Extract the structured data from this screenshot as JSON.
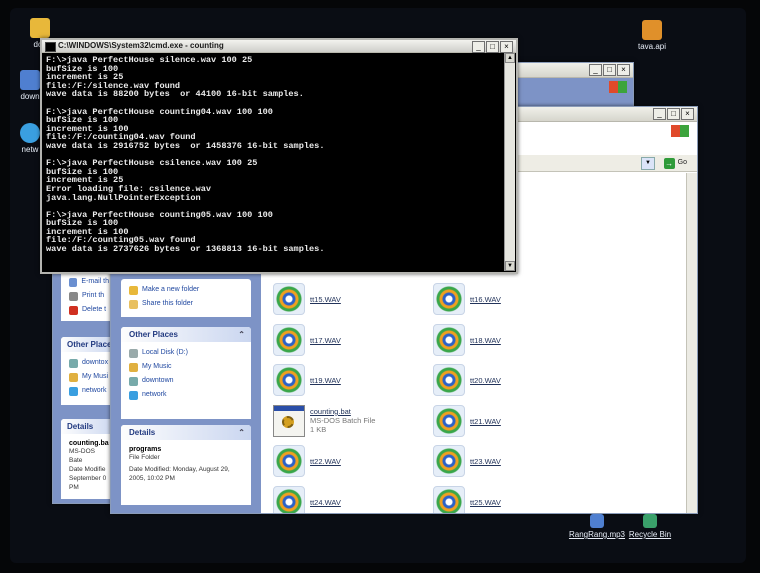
{
  "desktop": {
    "icons": [
      {
        "label": "doc",
        "icon": "folder-icon"
      },
      {
        "label": "down",
        "icon": "computer-icon"
      },
      {
        "label": "netw",
        "icon": "network-icon"
      },
      {
        "label": "tava.api",
        "icon": "key-icon"
      }
    ],
    "bottom_icons": [
      {
        "label": "RangRang.mp3",
        "icon": "audio-file-icon"
      },
      {
        "label": "Recycle Bin",
        "icon": "recycle-bin-icon"
      }
    ]
  },
  "cmd": {
    "title": "C:\\WINDOWS\\System32\\cmd.exe - counting",
    "lines": [
      "F:\\>java PerfectHouse silence.wav 100 25",
      "bufSize is 100",
      "increment is 25",
      "file:/F:/silence.wav found",
      "wave data is 88200 bytes  or 44100 16-bit samples.",
      "",
      "F:\\>java PerfectHouse counting04.wav 100 100",
      "bufSize is 100",
      "increment is 100",
      "file:/F:/counting04.wav found",
      "wave data is 2916752 bytes  or 1458376 16-bit samples.",
      "",
      "F:\\>java PerfectHouse csilence.wav 100 25",
      "bufSize is 100",
      "increment is 25",
      "Error loading file: csilence.wav",
      "java.lang.NullPointerException",
      "",
      "F:\\>java PerfectHouse counting05.wav 100 100",
      "bufSize is 100",
      "increment is 100",
      "file:/F:/counting05.wav found",
      "wave data is 2737626 bytes  or 1368813 16-bit samples."
    ]
  },
  "explorer_back": {
    "tasks": [
      "E-mail th",
      "Print th",
      "Delete t"
    ],
    "other_places_title": "Other Places",
    "other_places": [
      "downtox",
      "My Musi",
      "network"
    ],
    "details_title": "Details",
    "details_name": "counting.ba",
    "details_lines": [
      "MS-DOS Bate",
      "Date Modifie",
      "September 0",
      "PM"
    ]
  },
  "explorer_front": {
    "go_label": "Go",
    "tasks": [
      "Make a new folder",
      "Share this folder"
    ],
    "other_places_title": "Other Places",
    "other_places": [
      "Local Disk (D:)",
      "My Music",
      "downtown",
      "network"
    ],
    "details_title": "Details",
    "details_name": "programs",
    "details_type": "File Folder",
    "details_date": "Date Modified: Monday, August 29, 2005, 10:02 PM",
    "files": [
      {
        "name": "tt15.WAV",
        "kind": "wav"
      },
      {
        "name": "tt16.WAV",
        "kind": "wav"
      },
      {
        "name": "tt17.WAV",
        "kind": "wav"
      },
      {
        "name": "tt18.WAV",
        "kind": "wav"
      },
      {
        "name": "tt19.WAV",
        "kind": "wav"
      },
      {
        "name": "tt20.WAV",
        "kind": "wav"
      },
      {
        "name": "counting.bat",
        "kind": "bat",
        "sub1": "MS-DOS Batch File",
        "sub2": "1 KB"
      },
      {
        "name": "tt21.WAV",
        "kind": "wav"
      },
      {
        "name": "tt22.WAV",
        "kind": "wav"
      },
      {
        "name": "tt23.WAV",
        "kind": "wav"
      },
      {
        "name": "tt24.WAV",
        "kind": "wav"
      },
      {
        "name": "tt25.WAV",
        "kind": "wav"
      }
    ]
  },
  "colors": {
    "console_bg": "#000000",
    "console_text": "#ececec",
    "xp_blue": "#223a80"
  }
}
